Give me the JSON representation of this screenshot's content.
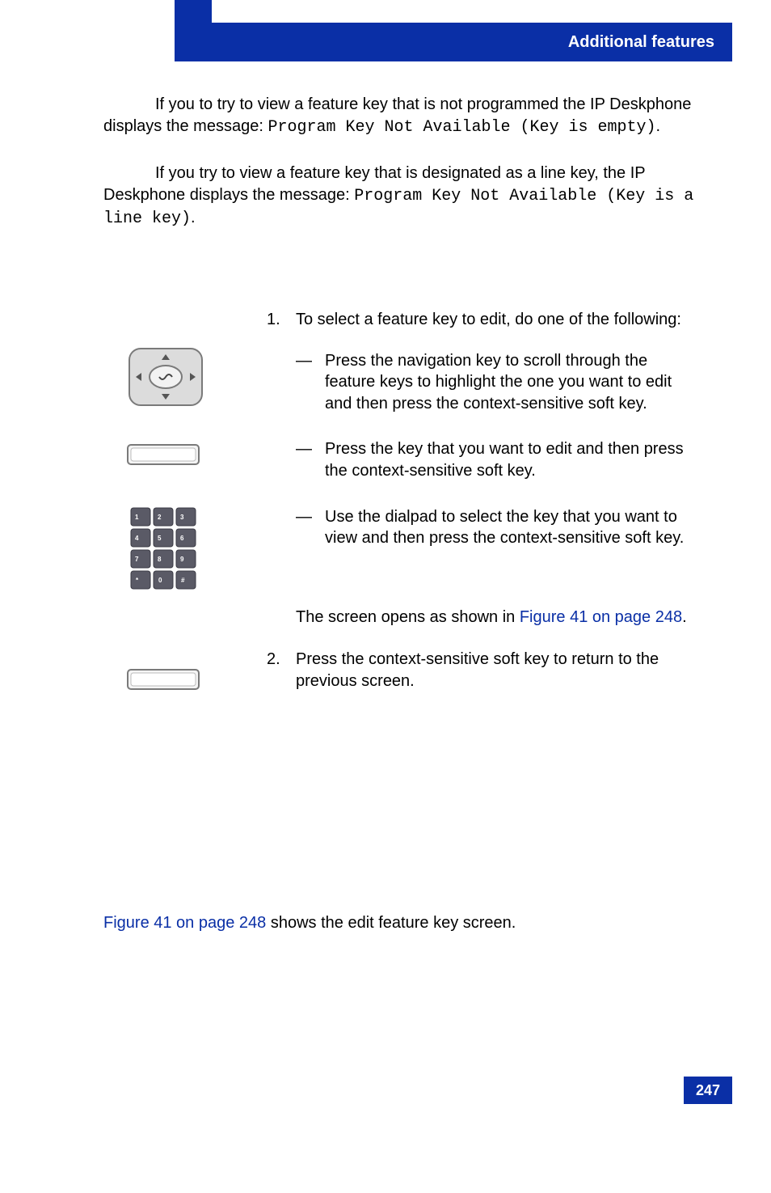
{
  "header": {
    "title": "Additional features"
  },
  "para1": {
    "lead_a": "If you to try to view a feature key that is not programmed the IP Deskphone displays the message: ",
    "code": "Program Key Not Available (Key is empty)",
    "period": "."
  },
  "para2": {
    "lead_a": "If you try to view a feature key that is designated as a line key, the IP Deskphone displays the message: ",
    "code": "Program Key Not Available (Key is a line key)",
    "period": "."
  },
  "step1": {
    "num": "1.",
    "lead": "To select a feature key to edit, do one of the following:",
    "bullet_a": "Press the              navigation key to scroll through the feature keys to highlight the one you want to edit and then press the      context-sensitive soft key.",
    "bullet_b": "Press the             key that you want to edit and then press the       context-sensitive soft key.",
    "bullet_c": "Use the dialpad to select the                 key that you want to view and then press the      context-sensitive soft key.",
    "result_a": "The                      screen opens as shown in ",
    "result_link": "Figure 41 on page 248",
    "result_b": "."
  },
  "step2": {
    "num": "2.",
    "text": "Press the         context-sensitive soft key to return to the previous screen."
  },
  "closing": {
    "link": "Figure 41 on page 248",
    "rest": " shows the edit feature key screen."
  },
  "page_number": "247",
  "icons": {
    "nav": "navigation-pad-icon",
    "softkey": "softkey-icon",
    "dialpad": "dialpad-icon"
  }
}
